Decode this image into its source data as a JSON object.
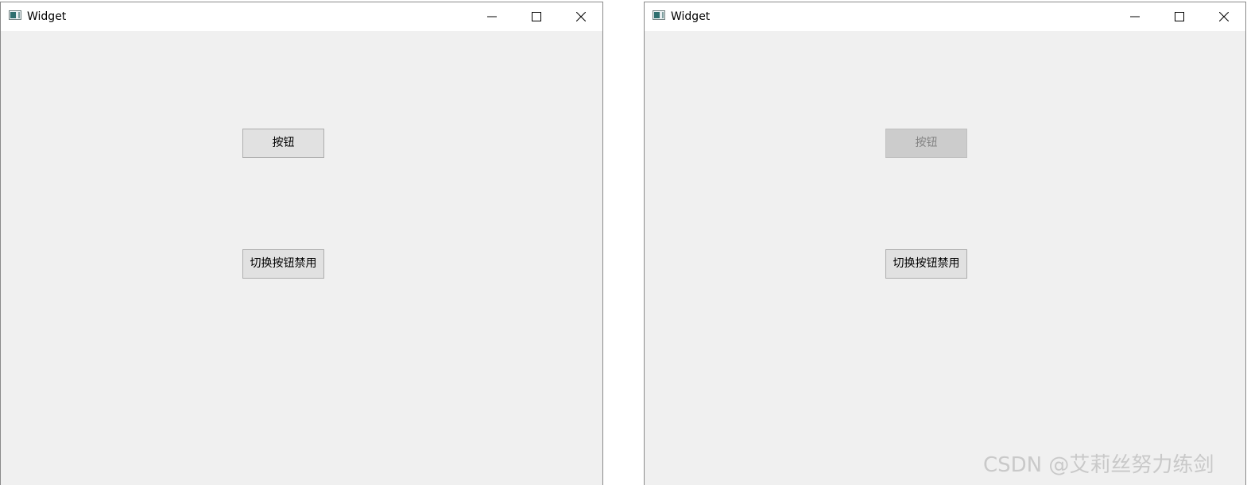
{
  "windows": [
    {
      "title": "Widget",
      "buttons": [
        {
          "label": "按钮",
          "disabled": false
        },
        {
          "label": "切换按钮禁用",
          "disabled": false
        }
      ]
    },
    {
      "title": "Widget",
      "buttons": [
        {
          "label": "按钮",
          "disabled": true
        },
        {
          "label": "切换按钮禁用",
          "disabled": false
        }
      ]
    }
  ],
  "watermark": "CSDN @艾莉丝努力练剑",
  "colors": {
    "client_bg": "#f0f0f0",
    "button_bg": "#e1e1e1",
    "button_disabled_bg": "#cccccc",
    "button_disabled_text": "#838383"
  },
  "icons": [
    "app-icon",
    "minimize-icon",
    "maximize-icon",
    "close-icon"
  ]
}
